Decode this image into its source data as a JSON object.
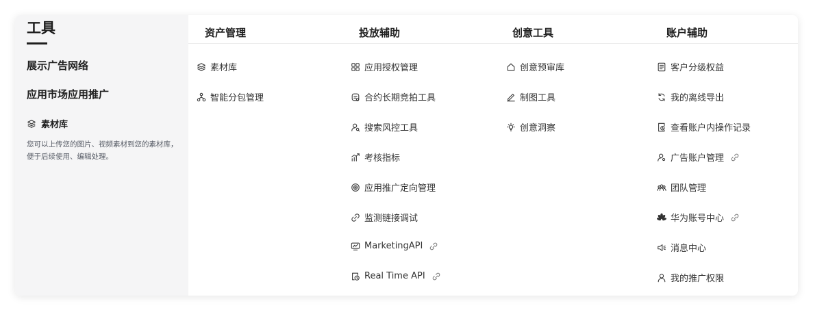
{
  "left": {
    "title": "工具",
    "links": [
      "展示广告网络",
      "应用市场应用推广"
    ],
    "feature_title": "素材库",
    "feature_desc": "您可以上传您的图片、视频素材到您的素材库，便于后续使用、编辑处理。"
  },
  "columns": [
    {
      "title": "资产管理",
      "items": [
        {
          "label": "素材库",
          "icon": "layers-icon",
          "external": false
        },
        {
          "label": "智能分包管理",
          "icon": "hierarchy-icon",
          "external": false
        }
      ]
    },
    {
      "title": "投放辅助",
      "items": [
        {
          "label": "应用授权管理",
          "icon": "grid-icon",
          "external": false
        },
        {
          "label": "合约长期竞拍工具",
          "icon": "contract-icon",
          "external": false
        },
        {
          "label": "搜索风控工具",
          "icon": "user-search-icon",
          "external": false
        },
        {
          "label": "考核指标",
          "icon": "bar-chart-icon",
          "external": false
        },
        {
          "label": "应用推广定向管理",
          "icon": "target-icon",
          "external": false
        },
        {
          "label": "监测链接调试",
          "icon": "link-icon",
          "external": false
        },
        {
          "label": "MarketingAPI",
          "icon": "monitor-chart-icon",
          "external": true
        },
        {
          "label": "Real Time API",
          "icon": "clock-doc-icon",
          "external": true
        }
      ]
    },
    {
      "title": "创意工具",
      "items": [
        {
          "label": "创意预审库",
          "icon": "home-icon",
          "external": false
        },
        {
          "label": "制图工具",
          "icon": "pen-icon",
          "external": false
        },
        {
          "label": "创意洞察",
          "icon": "bulb-icon",
          "external": false
        }
      ]
    },
    {
      "title": "账户辅助",
      "items": [
        {
          "label": "客户分级权益",
          "icon": "document-icon",
          "external": false
        },
        {
          "label": "我的离线导出",
          "icon": "refresh-icon",
          "external": false
        },
        {
          "label": "查看账户内操作记录",
          "icon": "record-icon",
          "external": false
        },
        {
          "label": "广告账户管理",
          "icon": "user-gear-icon",
          "external": true
        },
        {
          "label": "团队管理",
          "icon": "team-icon",
          "external": false
        },
        {
          "label": "华为账号中心",
          "icon": "huawei-icon",
          "external": true
        },
        {
          "label": "消息中心",
          "icon": "speaker-icon",
          "external": false
        },
        {
          "label": "我的推广权限",
          "icon": "user-icon",
          "external": false
        }
      ]
    }
  ]
}
